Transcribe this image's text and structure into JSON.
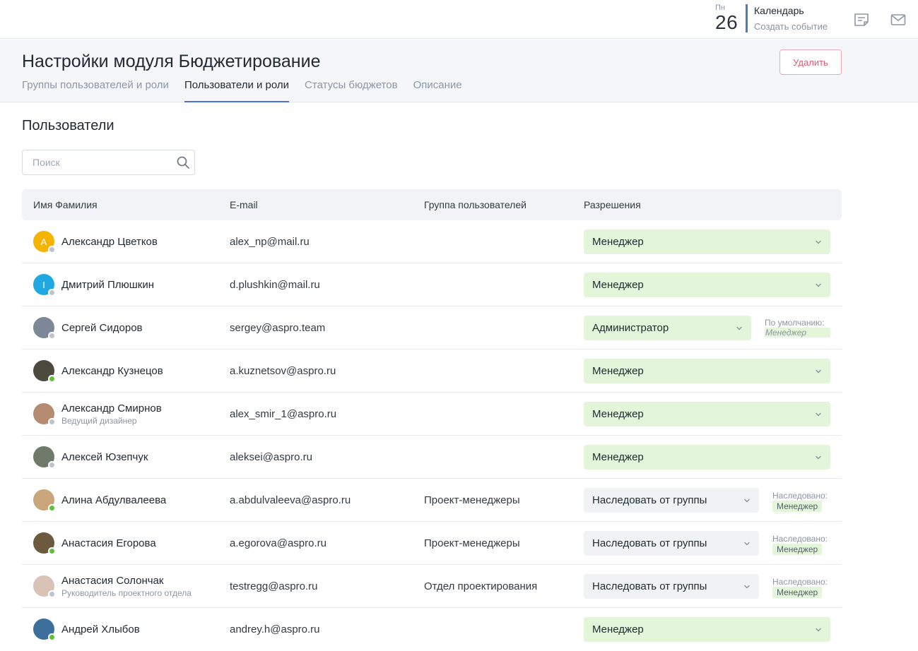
{
  "topbar": {
    "calendar_weekday": "Пн",
    "calendar_date": "26",
    "calendar_title": "Календарь",
    "calendar_create": "Создать событие"
  },
  "header": {
    "title": "Настройки модуля Бюджетирование",
    "delete_label": "Удалить",
    "tabs": [
      {
        "label": "Группы пользователей и роли"
      },
      {
        "label": "Пользователи и роли"
      },
      {
        "label": "Статусы бюджетов"
      },
      {
        "label": "Описание"
      }
    ],
    "active_tab": "Пользователи и роли"
  },
  "section_title": "Пользователи",
  "search": {
    "placeholder": "Поиск"
  },
  "table": {
    "columns": [
      "Имя Фамилия",
      "E-mail",
      "Группа пользователей",
      "Разрешения"
    ],
    "rows": [
      {
        "name": "Александр Цветков",
        "subtitle": "",
        "email": "alex_np@mail.ru",
        "group": "",
        "permission": "Менеджер",
        "initial": "A",
        "avatar_color": "#f5b400",
        "online": false
      },
      {
        "name": "Дмитрий Плюшкин",
        "subtitle": "",
        "email": "d.plushkin@mail.ru",
        "group": "",
        "permission": "Менеджер",
        "initial": "I",
        "avatar_color": "#1fa9e0",
        "online": false
      },
      {
        "name": "Сергей Сидоров",
        "subtitle": "",
        "email": "sergey@aspro.team",
        "group": "",
        "permission": "Администратор",
        "note_label": "По умолчанию:",
        "note_value": "Менеджер",
        "avatar_color": "#7d8896",
        "online": false
      },
      {
        "name": "Александр Кузнецов",
        "subtitle": "",
        "email": "a.kuznetsov@aspro.ru",
        "group": "",
        "permission": "Менеджер",
        "avatar_color": "#4b4a3f",
        "online": true
      },
      {
        "name": "Александр Смирнов",
        "subtitle": "Ведущий дизайнер",
        "email": "alex_smir_1@aspro.ru",
        "group": "",
        "permission": "Менеджер",
        "avatar_color": "#b58c72",
        "online": false
      },
      {
        "name": "Алексей Юзепчук",
        "subtitle": "",
        "email": "aleksei@aspro.ru",
        "group": "",
        "permission": "Менеджер",
        "avatar_color": "#6f7a6a",
        "online": false
      },
      {
        "name": "Алина Абдулвалеева",
        "subtitle": "",
        "email": "a.abdulvaleeva@aspro.ru",
        "group": "Проект-менеджеры",
        "permission": "Наследовать от группы",
        "note_label": "Наследовано:",
        "note_value": "Менеджер",
        "avatar_color": "#c9a77a",
        "online": true
      },
      {
        "name": "Анастасия Егорова",
        "subtitle": "",
        "email": "a.egorova@aspro.ru",
        "group": "Проект-менеджеры",
        "permission": "Наследовать от группы",
        "note_label": "Наследовано:",
        "note_value": "Менеджер",
        "avatar_color": "#6b5a3e",
        "online": true
      },
      {
        "name": "Анастасия Солончак",
        "subtitle": "Руководитель проектного отдела",
        "email": "testregg@aspro.ru",
        "group": "Отдел проектирования",
        "permission": "Наследовать от группы",
        "note_label": "Наследовано:",
        "note_value": "Менеджер",
        "avatar_color": "#d9c3b6",
        "online": false
      },
      {
        "name": "Андрей Хлыбов",
        "subtitle": "",
        "email": "andrey.h@aspro.ru",
        "group": "",
        "permission": "Менеджер",
        "avatar_color": "#3d6f9c",
        "online": true
      }
    ]
  },
  "colors": {
    "accent": "#4a6fd6",
    "delete": "#e05a72",
    "permission_bg": "#e3f6d9",
    "inherit_bg": "#f1f2f6",
    "online": "#5fbf3a",
    "offline": "#bfc4cc"
  },
  "icons": [
    "notes-icon",
    "mail-icon",
    "search-icon",
    "chevron-down-icon"
  ]
}
